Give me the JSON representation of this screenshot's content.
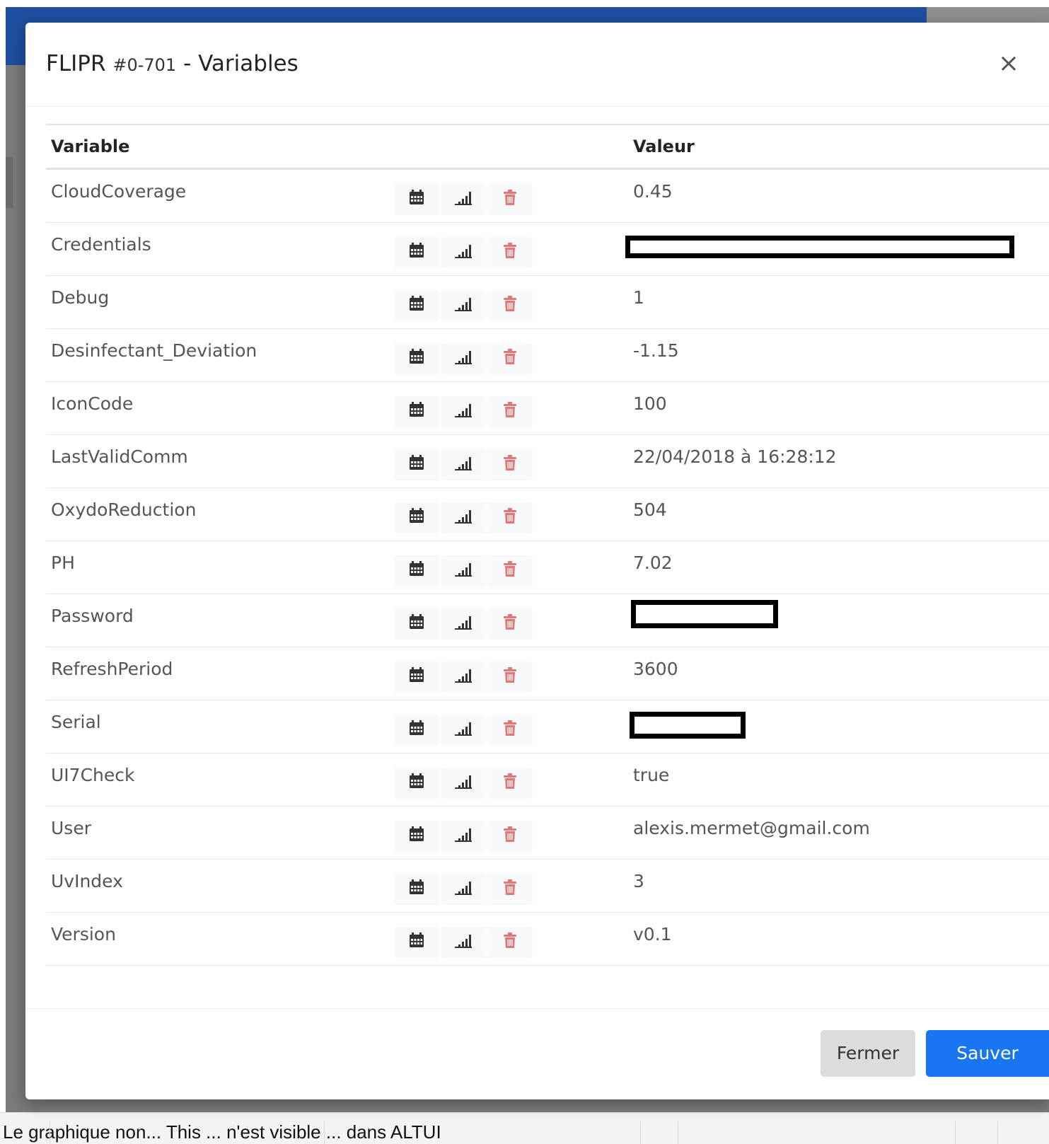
{
  "modal": {
    "title_prefix": "FLIPR",
    "device_id": "#0-701",
    "title_sep": "-",
    "title_suffix": "Variables",
    "close_glyph": "×"
  },
  "table": {
    "headers": [
      "Variable",
      "",
      "Valeur"
    ],
    "rows": [
      {
        "name": "CloudCoverage",
        "value": "0.45"
      },
      {
        "name": "Credentials",
        "value": "",
        "redacted": true
      },
      {
        "name": "Debug",
        "value": "1"
      },
      {
        "name": "Desinfectant_Deviation",
        "value": "-1.15"
      },
      {
        "name": "IconCode",
        "value": "100"
      },
      {
        "name": "LastValidComm",
        "value": "22/04/2018 à 16:28:12"
      },
      {
        "name": "OxydoReduction",
        "value": "504"
      },
      {
        "name": "PH",
        "value": "7.02"
      },
      {
        "name": "Password",
        "value": "",
        "redacted": true
      },
      {
        "name": "RefreshPeriod",
        "value": "3600"
      },
      {
        "name": "Serial",
        "value": "",
        "redacted": true
      },
      {
        "name": "UI7Check",
        "value": "true"
      },
      {
        "name": "User",
        "value": "alexis.mermet@gmail.com"
      },
      {
        "name": "UvIndex",
        "value": "3"
      },
      {
        "name": "Version",
        "value": "v0.1"
      }
    ],
    "row_actions": [
      "calendar-icon",
      "chart-icon",
      "trash-icon"
    ]
  },
  "footer": {
    "close_label": "Fermer",
    "save_label": "Sauver"
  },
  "bottom_text": "Le graphique non... This ... n'est visible ... dans ALTUI",
  "colors": {
    "topbar": "#1f4fa0",
    "primary": "#1976f2",
    "secondary": "#dcdcdc",
    "trash": "#d9534f",
    "icon": "#333333"
  }
}
